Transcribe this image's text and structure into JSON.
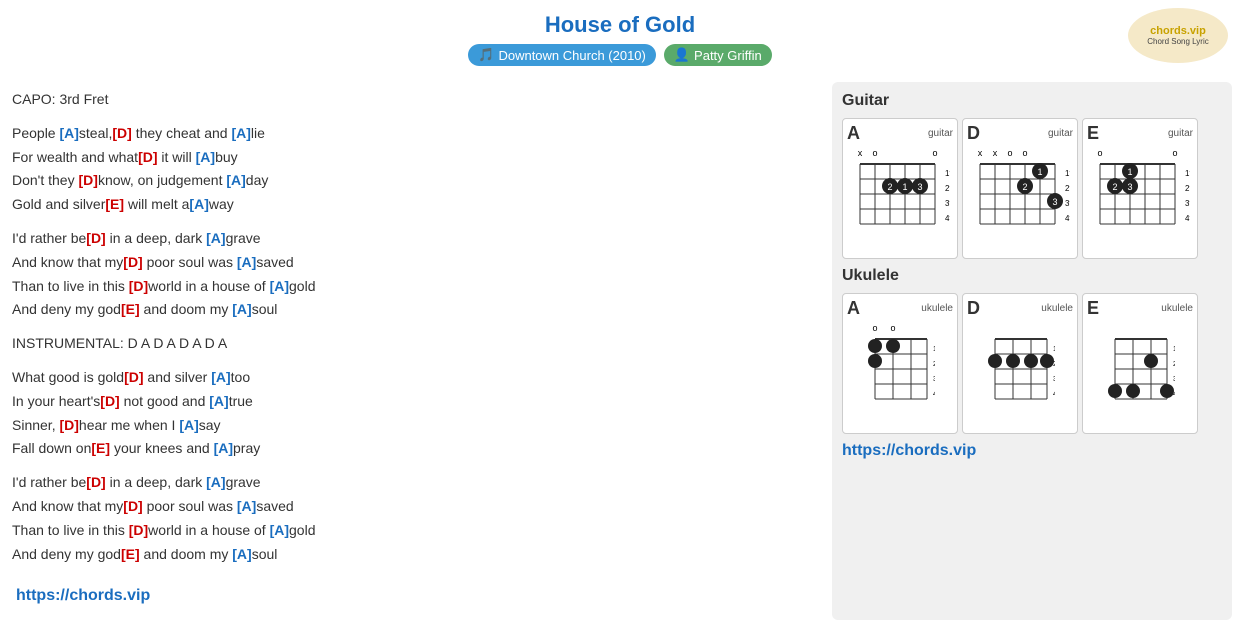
{
  "header": {
    "title": "House of Gold",
    "badge_album": "Downtown Church (2010)",
    "badge_artist": "Patty Griffin"
  },
  "capo": "CAPO: 3rd Fret",
  "lyrics": [
    {
      "type": "verse",
      "lines": [
        [
          {
            "text": "People "
          },
          {
            "text": "[A]",
            "class": "chord-blue"
          },
          {
            "text": "steal,"
          },
          {
            "text": "[D]",
            "class": "chord-red"
          },
          {
            "text": " they cheat and "
          },
          {
            "text": "[A]",
            "class": "chord-blue"
          },
          {
            "text": "lie"
          }
        ],
        [
          {
            "text": "For wealth and what"
          },
          {
            "text": "[D]",
            "class": "chord-red"
          },
          {
            "text": " it will "
          },
          {
            "text": "[A]",
            "class": "chord-blue"
          },
          {
            "text": "buy"
          }
        ],
        [
          {
            "text": "Don't they "
          },
          {
            "text": "[D]",
            "class": "chord-red"
          },
          {
            "text": "know, on judgement "
          },
          {
            "text": "[A]",
            "class": "chord-blue"
          },
          {
            "text": "day"
          }
        ],
        [
          {
            "text": "Gold and silver"
          },
          {
            "text": "[E]",
            "class": "chord-red"
          },
          {
            "text": " will melt a"
          },
          {
            "text": "[A]",
            "class": "chord-blue"
          },
          {
            "text": "way"
          }
        ]
      ]
    },
    {
      "type": "verse",
      "lines": [
        [
          {
            "text": "I'd rather be"
          },
          {
            "text": "[D]",
            "class": "chord-red"
          },
          {
            "text": " in a deep, dark "
          },
          {
            "text": "[A]",
            "class": "chord-blue"
          },
          {
            "text": "grave"
          }
        ],
        [
          {
            "text": "And know that my"
          },
          {
            "text": "[D]",
            "class": "chord-red"
          },
          {
            "text": " poor soul was "
          },
          {
            "text": "[A]",
            "class": "chord-blue"
          },
          {
            "text": "saved"
          }
        ],
        [
          {
            "text": "Than to live in this "
          },
          {
            "text": "[D]",
            "class": "chord-red"
          },
          {
            "text": "world in a house of "
          },
          {
            "text": "[A]",
            "class": "chord-blue"
          },
          {
            "text": "gold"
          }
        ],
        [
          {
            "text": "And deny my god"
          },
          {
            "text": "[E]",
            "class": "chord-red"
          },
          {
            "text": " and doom my "
          },
          {
            "text": "[A]",
            "class": "chord-blue"
          },
          {
            "text": "soul"
          }
        ]
      ]
    },
    {
      "type": "instrumental",
      "lines": [
        [
          {
            "text": "INSTRUMENTAL: D A D A D A D A"
          }
        ]
      ]
    },
    {
      "type": "verse",
      "lines": [
        [
          {
            "text": "What good is gold"
          },
          {
            "text": "[D]",
            "class": "chord-red"
          },
          {
            "text": " and silver "
          },
          {
            "text": "[A]",
            "class": "chord-blue"
          },
          {
            "text": "too"
          }
        ],
        [
          {
            "text": "In your heart's"
          },
          {
            "text": "[D]",
            "class": "chord-red"
          },
          {
            "text": " not good and "
          },
          {
            "text": "[A]",
            "class": "chord-blue"
          },
          {
            "text": "true"
          }
        ],
        [
          {
            "text": "Sinner, "
          },
          {
            "text": "[D]",
            "class": "chord-red"
          },
          {
            "text": "hear me when I "
          },
          {
            "text": "[A]",
            "class": "chord-blue"
          },
          {
            "text": "say"
          }
        ],
        [
          {
            "text": "Fall down on"
          },
          {
            "text": "[E]",
            "class": "chord-red"
          },
          {
            "text": " your knees and "
          },
          {
            "text": "[A]",
            "class": "chord-blue"
          },
          {
            "text": "pray"
          }
        ]
      ]
    },
    {
      "type": "verse",
      "lines": [
        [
          {
            "text": "I'd rather be"
          },
          {
            "text": "[D]",
            "class": "chord-red"
          },
          {
            "text": " in a deep, dark "
          },
          {
            "text": "[A]",
            "class": "chord-blue"
          },
          {
            "text": "grave"
          }
        ],
        [
          {
            "text": "And know that my"
          },
          {
            "text": "[D]",
            "class": "chord-red"
          },
          {
            "text": " poor soul was "
          },
          {
            "text": "[A]",
            "class": "chord-blue"
          },
          {
            "text": "saved"
          }
        ],
        [
          {
            "text": "Than to live in this "
          },
          {
            "text": "[D]",
            "class": "chord-red"
          },
          {
            "text": "world in a house of "
          },
          {
            "text": "[A]",
            "class": "chord-blue"
          },
          {
            "text": "gold"
          }
        ],
        [
          {
            "text": "And deny my god"
          },
          {
            "text": "[E]",
            "class": "chord-red"
          },
          {
            "text": " and doom my "
          },
          {
            "text": "[A]",
            "class": "chord-blue"
          },
          {
            "text": "soul"
          }
        ]
      ]
    }
  ],
  "guitar_section": "Guitar",
  "ukulele_section": "Ukulele",
  "url": "https://chords.vip"
}
